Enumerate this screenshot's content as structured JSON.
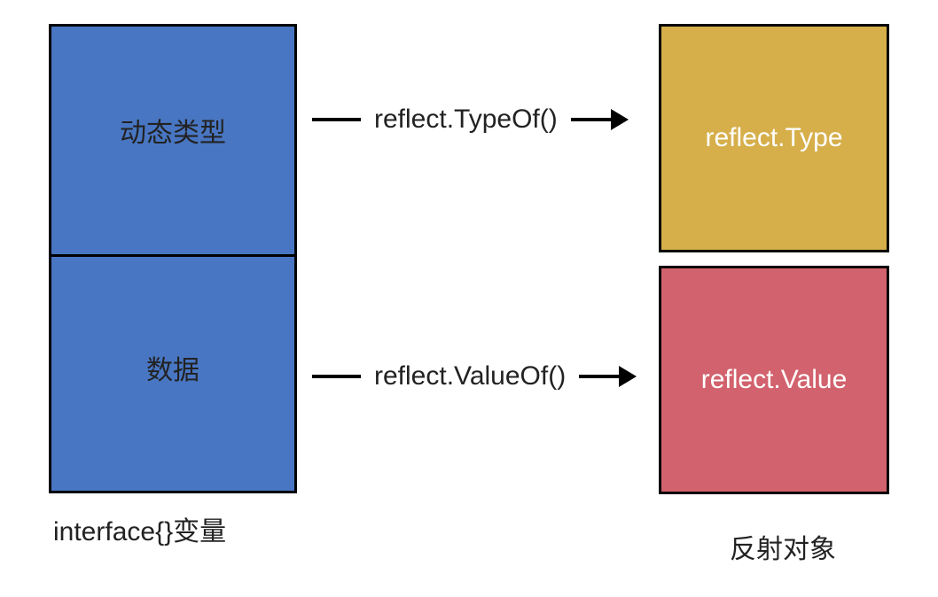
{
  "leftBox": {
    "topCell": "动态类型",
    "bottomCell": "数据"
  },
  "rightBox": {
    "typeBox": "reflect.Type",
    "valueBox": "reflect.Value"
  },
  "arrows": {
    "top": "reflect.TypeOf()",
    "bottom": "reflect.ValueOf()"
  },
  "labels": {
    "left": "interface{}变量",
    "right": "反射对象"
  }
}
